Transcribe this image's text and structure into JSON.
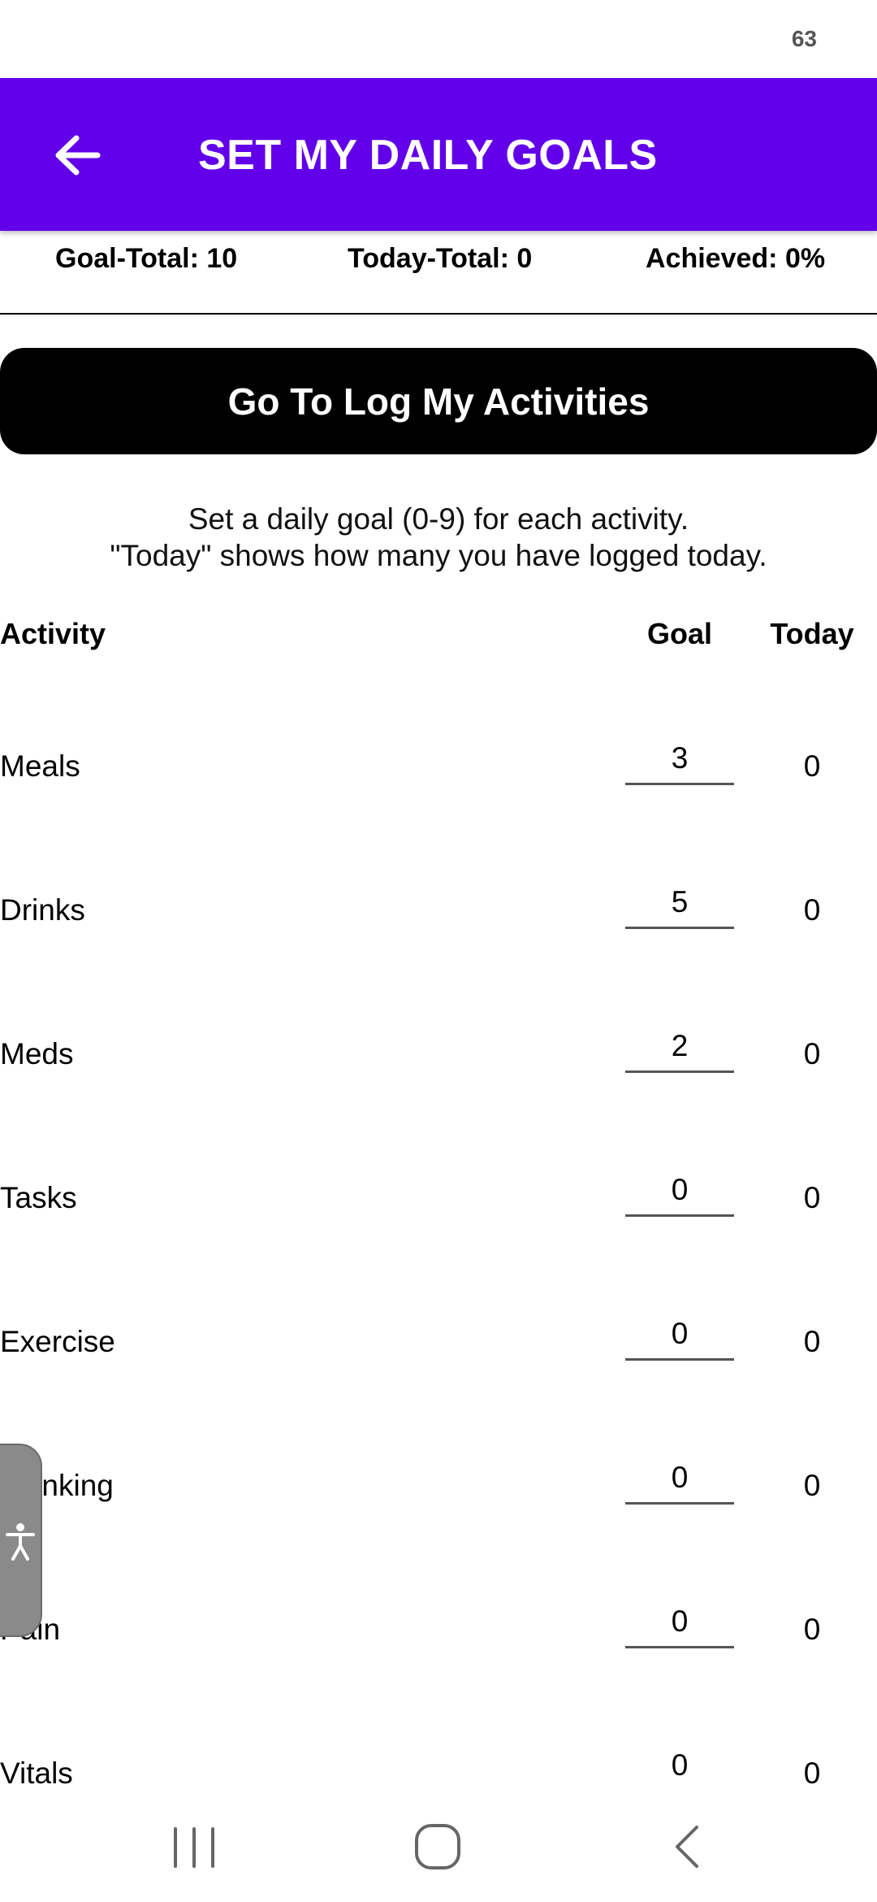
{
  "status_bar": {
    "battery": "63"
  },
  "app_bar": {
    "title": "SET MY DAILY GOALS",
    "back_icon": "arrow-left-icon"
  },
  "summary": {
    "goal_total": "Goal-Total: 10",
    "today_total": "Today-Total: 0",
    "achieved": "Achieved: 0%"
  },
  "log_button": {
    "label": "Go To Log My Activities"
  },
  "instructions": {
    "line1": "Set a daily goal (0-9) for each activity.",
    "line2": "\"Today\" shows how many you have logged today."
  },
  "table": {
    "headers": {
      "activity": "Activity",
      "goal": "Goal",
      "today": "Today"
    },
    "rows": [
      {
        "name": "Meals",
        "goal": "3",
        "today": "0"
      },
      {
        "name": "Drinks",
        "goal": "5",
        "today": "0"
      },
      {
        "name": "Meds",
        "goal": "2",
        "today": "0"
      },
      {
        "name": "Tasks",
        "goal": "0",
        "today": "0"
      },
      {
        "name": "Exercise",
        "goal": "0",
        "today": "0"
      },
      {
        "name": "Thinking",
        "goal": "0",
        "today": "0"
      },
      {
        "name": "Pain",
        "goal": "0",
        "today": "0"
      },
      {
        "name": "Vitals",
        "goal": "0",
        "today": "0"
      }
    ]
  },
  "colors": {
    "app_bar": "#6200ea",
    "button": "#000000",
    "handle": "#8a8a8a"
  },
  "icons": {
    "accessibility": "accessibility-icon",
    "nav_recents": "recents-icon",
    "nav_home": "home-icon",
    "nav_back": "chevron-left-icon"
  }
}
